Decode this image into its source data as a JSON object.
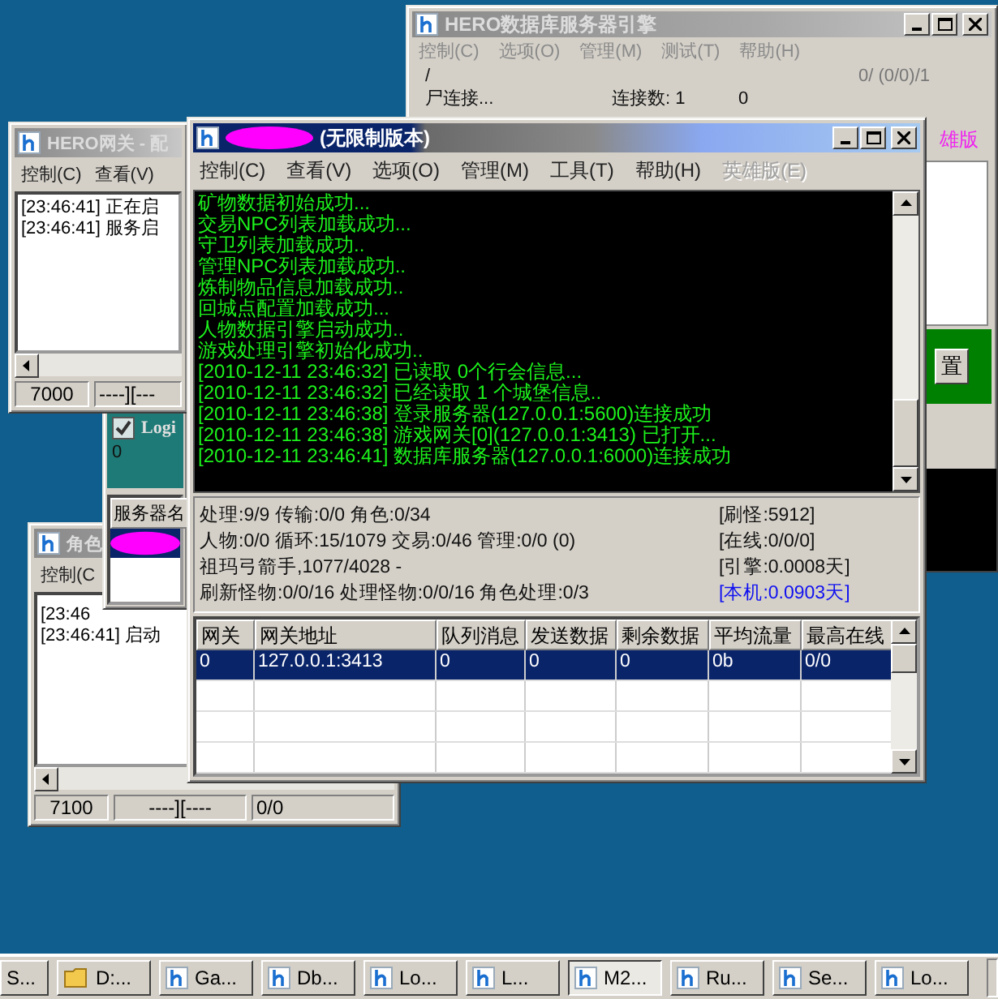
{
  "db_window": {
    "title": "HERO数据库服务器引擎",
    "menu": [
      "控制(C)",
      "选项(O)",
      "管理(M)",
      "测试(T)",
      "帮助(H)"
    ],
    "path_text": "/",
    "counter": "0/ (0/0)/1",
    "status_text": "尸连接...",
    "connections": "连接数: 1",
    "connections_extra": "0",
    "edition_text": "雄版",
    "button": "置"
  },
  "gateway_window": {
    "title": "HERO网关 - 配",
    "menu": [
      "控制(C)",
      "查看(V)"
    ],
    "log": [
      "[23:46:41] 正在启",
      "[23:46:41] 服务启"
    ],
    "status": [
      "7000",
      "----][---"
    ]
  },
  "login_window": {
    "checkbox": {
      "label": "Logi",
      "checked": true
    },
    "count": "0",
    "list_header": "服务器名",
    "rows": [
      {
        "selected": true
      }
    ]
  },
  "role_window": {
    "title": "角色",
    "menu": [
      "控制(C"
    ],
    "log": [
      "[23:46",
      "[23:46:41] 启动"
    ],
    "status": [
      "7100",
      "----][----",
      "0/0"
    ]
  },
  "main_window": {
    "title": "(无限制版本)",
    "menu": [
      {
        "label": "控制(C)",
        "disabled": false
      },
      {
        "label": "查看(V)",
        "disabled": false
      },
      {
        "label": "选项(O)",
        "disabled": false
      },
      {
        "label": "管理(M)",
        "disabled": false
      },
      {
        "label": "工具(T)",
        "disabled": false
      },
      {
        "label": "帮助(H)",
        "disabled": false
      },
      {
        "label": "英雄版(E)",
        "disabled": true
      }
    ],
    "log": [
      "矿物数据初始成功...",
      "交易NPC列表加载成功...",
      "守卫列表加载成功..",
      "管理NPC列表加载成功..",
      "炼制物品信息加载成功..",
      "回城点配置加载成功...",
      "人物数据引擎启动成功..",
      "游戏处理引擎初始化成功..",
      "[2010-12-11 23:46:32] 已读取 0个行会信息...",
      "[2010-12-11 23:46:32] 已经读取 1 个城堡信息..",
      "[2010-12-11 23:46:38] 登录服务器(127.0.0.1:5600)连接成功",
      "[2010-12-11 23:46:38] 游戏网关[0](127.0.0.1:3413) 已打开...",
      "[2010-12-11 23:46:41] 数据库服务器(127.0.0.1:6000)连接成功"
    ],
    "stats": {
      "left": [
        "处理:9/9 传输:0/0 角色:0/34",
        "人物:0/0 循环:15/1079 交易:0/46 管理:0/0 (0)",
        "祖玛弓箭手,1077/4028 -",
        "刷新怪物:0/0/16 处理怪物:0/0/16 角色处理:0/3"
      ],
      "right": [
        {
          "text": "[刷怪:5912]",
          "highlight": false
        },
        {
          "text": "[在线:0/0/0]",
          "highlight": false
        },
        {
          "text": "[引擎:0.0008天]",
          "highlight": false
        },
        {
          "text": "[本机:0.0903天]",
          "highlight": true
        }
      ]
    },
    "table": {
      "columns": [
        "网关",
        "网关地址",
        "队列消息",
        "发送数据",
        "剩余数据",
        "平均流量",
        "最高在线"
      ],
      "rows": [
        {
          "cells": [
            "0",
            "127.0.0.1:3413",
            "0",
            "0",
            "0",
            "0b",
            "0/0"
          ],
          "selected": true
        }
      ]
    }
  },
  "taskbar": {
    "buttons": [
      {
        "label": "S...",
        "kind": "plain",
        "selected": false
      },
      {
        "label": "D:...",
        "kind": "folder",
        "selected": false
      },
      {
        "label": "Ga...",
        "kind": "app",
        "selected": false
      },
      {
        "label": "Db...",
        "kind": "app",
        "selected": false
      },
      {
        "label": "Lo...",
        "kind": "app",
        "selected": false
      },
      {
        "label": "L...",
        "kind": "app",
        "selected": false
      },
      {
        "label": "M2...",
        "kind": "app",
        "selected": true
      },
      {
        "label": "Ru...",
        "kind": "app",
        "selected": false
      },
      {
        "label": "Se...",
        "kind": "app",
        "selected": false
      },
      {
        "label": "Lo...",
        "kind": "app",
        "selected": false
      }
    ]
  }
}
